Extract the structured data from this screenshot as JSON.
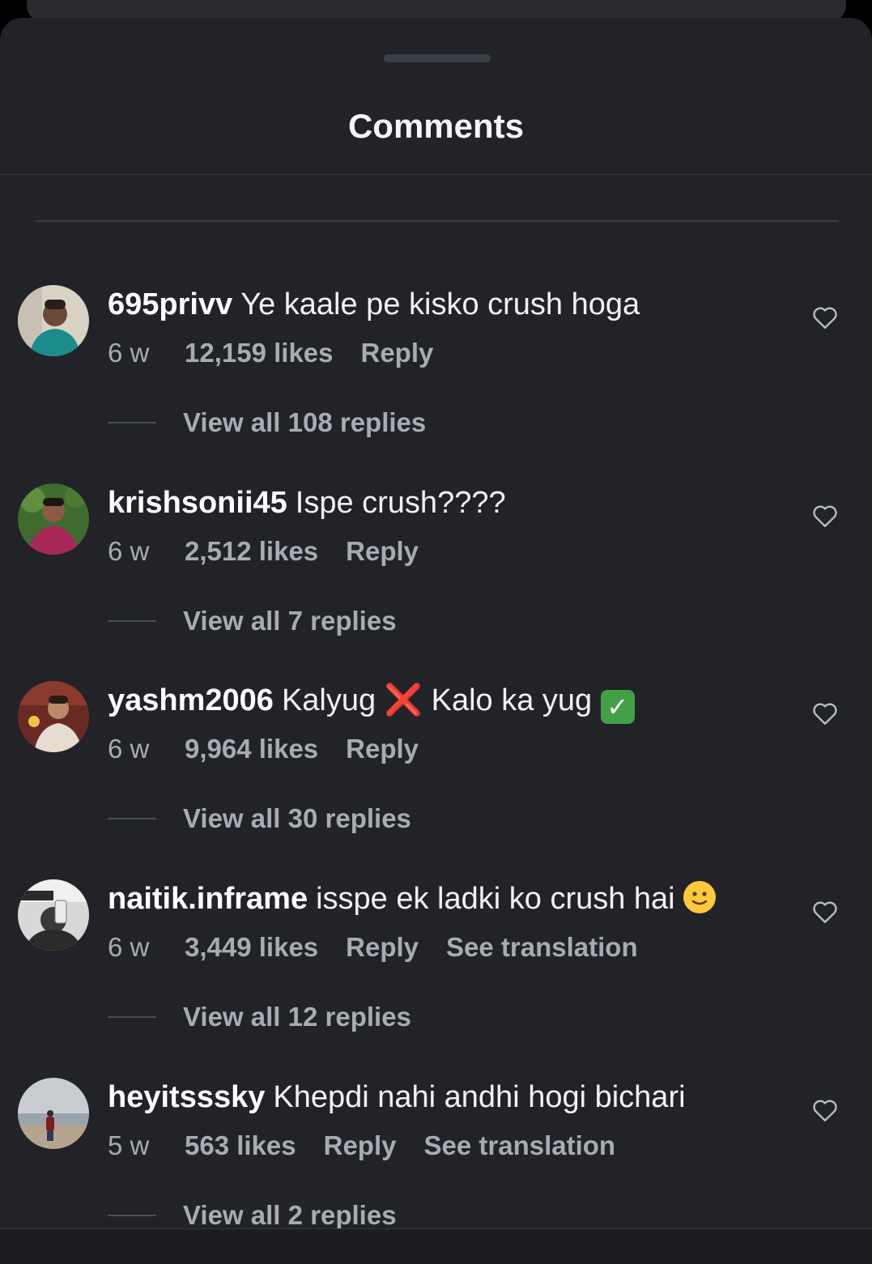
{
  "sheet": {
    "title": "Comments"
  },
  "comments": [
    {
      "username": "695privv",
      "text": "Ye kaale pe kisko crush hoga",
      "time": "6 w",
      "likes": "12,159 likes",
      "reply": "Reply",
      "view_replies": "View all 108 replies"
    },
    {
      "username": "krishsonii45",
      "text": "Ispe crush????",
      "time": "6 w",
      "likes": "2,512 likes",
      "reply": "Reply",
      "view_replies": "View all 7 replies"
    },
    {
      "username": "yashm2006",
      "text_part1": "Kalyug",
      "emoji1": "❌",
      "text_part2": "Kalo ka yug",
      "emoji2": "✓",
      "time": "6 w",
      "likes": "9,964 likes",
      "reply": "Reply",
      "view_replies": "View all 30 replies"
    },
    {
      "username": "naitik.inframe",
      "text": "isspe ek ladki ko crush hai",
      "time": "6 w",
      "likes": "3,449 likes",
      "reply": "Reply",
      "translate": "See translation",
      "view_replies": "View all 12 replies"
    },
    {
      "username": "heyitsssky",
      "text": "Khepdi nahi andhi hogi bichari",
      "time": "5 w",
      "likes": "563 likes",
      "reply": "Reply",
      "translate": "See translation",
      "view_replies": "View all 2 replies"
    }
  ],
  "icons": {
    "like": "heart-outline-icon",
    "emoji_smile": "slightly-smiling-face-icon"
  }
}
